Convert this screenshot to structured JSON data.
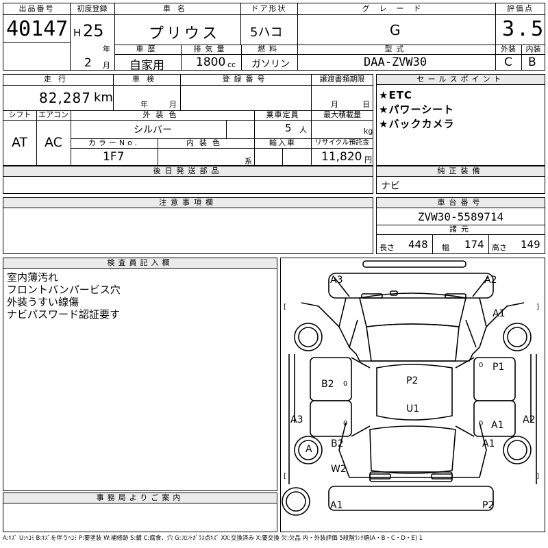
{
  "header": {
    "lot_no_label": "出品番号",
    "lot_no": "40147",
    "first_reg_label": "初度登録",
    "era": "H",
    "reg_year": "25",
    "year_unit": "年",
    "reg_month": "2",
    "month_unit": "月",
    "car_name_label": "車名",
    "car_name": "プリウス",
    "door_label": "ドア形状",
    "door_value": "5ハコ",
    "grade_label": "グレード",
    "grade_value": "G",
    "eval_label": "評価点",
    "eval_value": "3.5",
    "history_label": "車歴",
    "history_value": "自家用",
    "displacement_label": "排気量",
    "displacement_value": "1800",
    "displacement_unit": "cc",
    "fuel_label": "燃料",
    "fuel_value": "ガソリン",
    "model_label": "型式",
    "model_value": "DAA-ZVW30",
    "ext_label": "外装",
    "ext_value": "C",
    "int_label": "内装",
    "int_value": "B"
  },
  "specs": {
    "mileage_label": "走行",
    "mileage_value": "82,287",
    "mileage_unit": "km",
    "inspection_label": "車検",
    "insp_year_unit": "年",
    "insp_month_unit": "月",
    "reg_no_label": "登録番号",
    "transfer_label": "譲渡書類期限",
    "transfer_month_unit": "月",
    "transfer_day_unit": "日",
    "shift_label": "シフト",
    "shift_value": "AT",
    "ac_label": "エアコン",
    "ac_value": "AC",
    "ext_color_label": "外装色",
    "ext_color_value": "シルバー",
    "seats_label": "乗車定員",
    "seats_value": "5",
    "seats_unit": "人",
    "load_label": "最大積載量",
    "load_unit": "kg",
    "color_no_label": "カラーNo.",
    "color_no_value": "1F7",
    "int_color_label": "内装色",
    "int_color_unit": "系",
    "import_label": "輸入車",
    "recycle_label": "リサイクル預託金",
    "recycle_value": "11,820",
    "recycle_unit": "円"
  },
  "sales_points": {
    "title": "セールスポイント",
    "items": [
      "★ETC",
      "★パワーシート",
      "★バックカメラ"
    ]
  },
  "later_parts": {
    "title": "後日発送部品"
  },
  "genuine_equipment": {
    "title": "純正装備",
    "value": "ナビ"
  },
  "notes": {
    "title": "注意事項欄"
  },
  "chassis": {
    "title": "車台番号",
    "value": "ZVW30-5589714",
    "dims_title": "諸元",
    "length_label": "長さ",
    "length_value": "448",
    "width_label": "幅",
    "width_value": "174",
    "height_label": "高さ",
    "height_value": "149"
  },
  "inspector": {
    "title": "検査員記入欄",
    "lines": [
      "室内薄汚れ",
      "フロントバンパービス穴",
      "外装うすい線傷",
      "ナビパスワード認証要す"
    ]
  },
  "office": {
    "title": "事務局よりご案内"
  },
  "diagram": {
    "labels": {
      "top_left": "A3",
      "top_right": "A2",
      "right_top": "A1",
      "right_p1": "P1",
      "center_p2": "P2",
      "center_u1": "U1",
      "left_b2": "B2",
      "left_a3": "A3",
      "right_a1": "A1",
      "right_a2": "A2",
      "wheel_a": "A",
      "left_b2_lower": "B2",
      "right_a1_lower": "A1",
      "left_w2": "W2",
      "bottom_left": "A1",
      "bottom_right": "P2"
    },
    "zero": "0",
    "bracket_l": "[",
    "bracket_r": "]"
  },
  "legend": "A:ｷｽﾞ U:ﾍｺﾐ B:ｷｽﾞを伴うﾍｺﾐ P:要塗装 W:補修跡 S:錆 C:腐食、穴 G:ﾌﾛﾝﾄｶﾞﾗｽ点ｷｽﾞ XX:交換済み X:要交換 欠:欠品 内・外装評価 5段階ﾗﾝｸ順(A・B・C・D・E) 1"
}
